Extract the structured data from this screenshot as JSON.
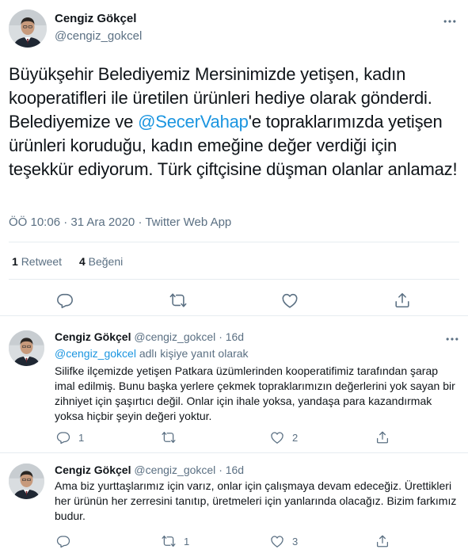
{
  "main_tweet": {
    "name": "Cengiz Gökçel",
    "handle": "@cengiz_gokcel",
    "text_part1": "Büyükşehir Belediyemiz Mersinimizde yetişen, kadın kooperatifleri ile üretilen ürünleri hediye olarak gönderdi. Belediyemize ve ",
    "mention": "@SecerVahap",
    "text_part2": "'e topraklarımızda yetişen ürünleri koruduğu, kadın emeğine değer verdiği için teşekkür ediyorum. Türk çiftçisine düşman olanlar anlamaz!",
    "meta": "ÖÖ 10:06 · 31 Ara 2020 · Twitter Web App",
    "retweet_count": "1",
    "retweet_label": "Retweet",
    "like_count": "4",
    "like_label": "Beğeni"
  },
  "replies": [
    {
      "name": "Cengiz Gökçel",
      "handle": "@cengiz_gokcel",
      "time": "· 16d",
      "replying_mention": "@cengiz_gokcel",
      "replying_suffix": " adlı kişiye yanıt olarak",
      "text": "Silifke ilçemizde yetişen Patkara üzümlerinden kooperatifimiz tarafından şarap imal edilmiş. Bunu başka yerlere çekmek topraklarımızın değerlerini yok sayan bir zihniyet için şaşırtıcı değil. Onlar için ihale yoksa, yandaşa para kazandırmak yoksa hiçbir şeyin değeri yoktur.",
      "reply_count": "1",
      "retweet_count": "",
      "like_count": "2"
    },
    {
      "name": "Cengiz Gökçel",
      "handle": "@cengiz_gokcel",
      "time": "· 16d",
      "text": "Ama biz yurttaşlarımız için varız, onlar için çalışmaya devam edeceğiz. Ürettikleri her ürünün her zerresini tanıtıp, üretmeleri için yanlarında olacağız. Bizim farkımız budur.",
      "reply_count": "",
      "retweet_count": "1",
      "like_count": "3"
    }
  ],
  "icons": {
    "more": "more-icon",
    "reply": "reply-icon",
    "retweet": "retweet-icon",
    "like": "heart-icon",
    "share": "share-icon"
  },
  "colors": {
    "link": "#1b95e0",
    "secondary_text": "#5b7083",
    "border": "#e6ecf0"
  }
}
